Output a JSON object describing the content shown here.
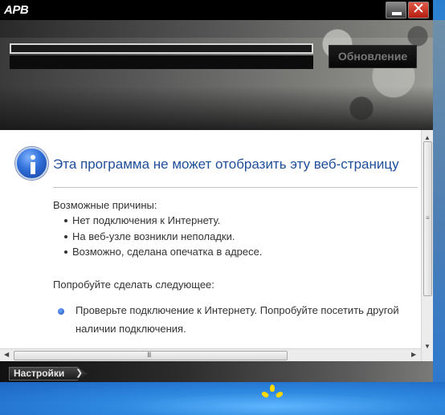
{
  "window": {
    "title": "APB",
    "close_glyph": "✕",
    "min_icon": "minimize-icon"
  },
  "launcher": {
    "update_button": "Обновление",
    "settings_button": "Настройки",
    "settings_chevron": "❯"
  },
  "page": {
    "icon": "info-icon",
    "error_title": "Эта программа не может отобразить эту веб-страницу",
    "causes_heading": "Возможные причины:",
    "causes": [
      "Нет подключения к Интернету.",
      "На веб-узле возникли неполадки.",
      "Возможно, сделана опечатка в адресе."
    ],
    "try_heading": "Попробуйте сделать следующее:",
    "suggestion_line1": "Проверьте подключение к Интернету. Попробуйте посетить другой",
    "suggestion_line2": "наличии подключения."
  },
  "scrollbars": {
    "up_arrow": "▲",
    "down_arrow": "▼",
    "left_arrow": "◀",
    "right_arrow": "▶",
    "grip_v": "≡",
    "grip_h": "III"
  }
}
